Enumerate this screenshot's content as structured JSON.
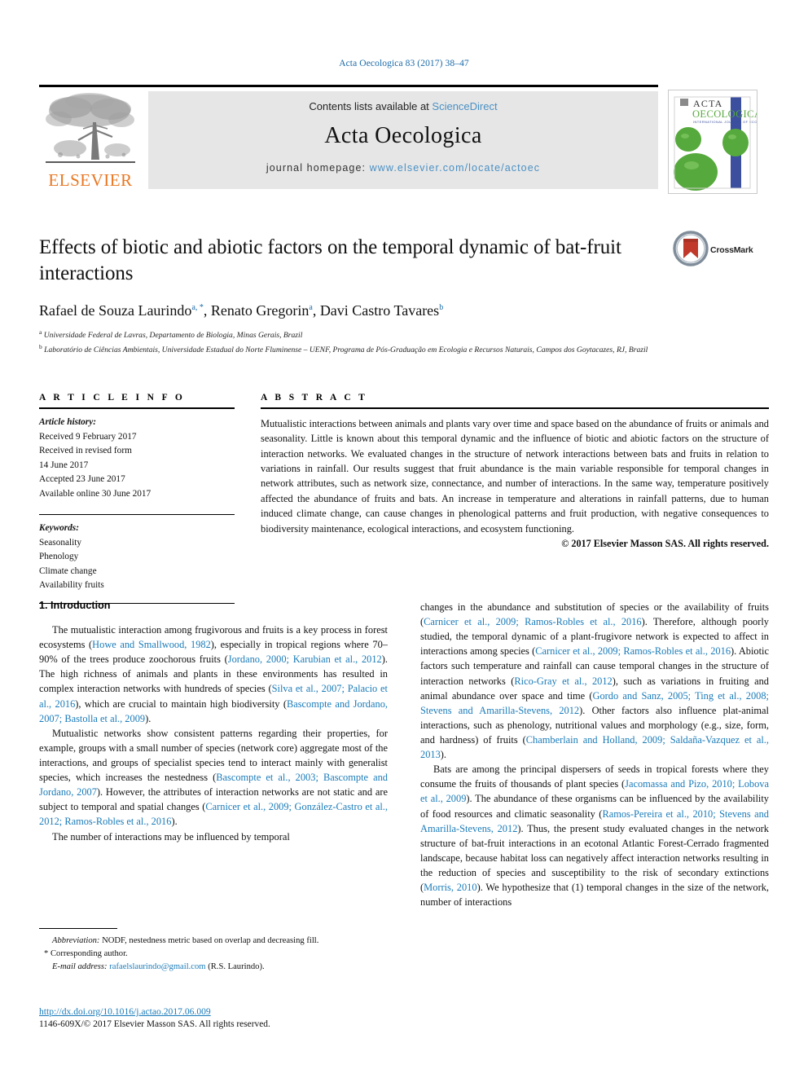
{
  "running_head": "Acta Oecologica 83 (2017) 38–47",
  "header": {
    "contents_prefix": "Contents lists available at ",
    "sciencedirect": "ScienceDirect",
    "journal_title": "Acta Oecologica",
    "homepage_prefix": "journal homepage: ",
    "homepage_url": "www.elsevier.com/locate/actoec",
    "publisher": "ELSEVIER",
    "cover_line1": "ACTA",
    "cover_line2": "OECOLOGICA",
    "cover_line3": "INTERNATIONAL JOURNAL OF ECOLOGY"
  },
  "colors": {
    "link": "#1a7bb9",
    "sciencedirect": "#4a90c4",
    "elsevier_orange": "#E87722",
    "band_gray": "#e6e6e6",
    "cover_green": "#56a93c",
    "cover_blue": "#3b4f9e",
    "crossmark_red": "#c0392b"
  },
  "title": "Effects of biotic and abiotic factors on the temporal dynamic of bat-fruit interactions",
  "authors": [
    {
      "name": "Rafael de Souza Laurindo",
      "marks": "a, *"
    },
    {
      "name": "Renato Gregorin",
      "marks": "a"
    },
    {
      "name": "Davi Castro Tavares",
      "marks": "b"
    }
  ],
  "affiliations": [
    {
      "mark": "a",
      "text": "Universidade Federal de Lavras, Departamento de Biologia, Minas Gerais, Brazil"
    },
    {
      "mark": "b",
      "text": "Laboratório de Ciências Ambientais, Universidade Estadual do Norte Fluminense – UENF, Programa de Pós-Graduação em Ecologia e Recursos Naturais, Campos dos Goytacazes, RJ, Brazil"
    }
  ],
  "crossmark": {
    "label": "CrossMark"
  },
  "article_info": {
    "heading": "A R T I C L E   I N F O",
    "history_label": "Article history:",
    "history": [
      "Received 9 February 2017",
      "Received in revised form",
      "14 June 2017",
      "Accepted 23 June 2017",
      "Available online 30 June 2017"
    ],
    "keywords_label": "Keywords:",
    "keywords": [
      "Seasonality",
      "Phenology",
      "Climate change",
      "Availability fruits"
    ]
  },
  "abstract": {
    "heading": "A B S T R A C T",
    "text": "Mutualistic interactions between animals and plants vary over time and space based on the abundance of fruits or animals and seasonality. Little is known about this temporal dynamic and the influence of biotic and abiotic factors on the structure of interaction networks. We evaluated changes in the structure of network interactions between bats and fruits in relation to variations in rainfall. Our results suggest that fruit abundance is the main variable responsible for temporal changes in network attributes, such as network size, connectance, and number of interactions. In the same way, temperature positively affected the abundance of fruits and bats. An increase in temperature and alterations in rainfall patterns, due to human induced climate change, can cause changes in phenological patterns and fruit production, with negative consequences to biodiversity maintenance, ecological interactions, and ecosystem functioning.",
    "copyright": "© 2017 Elsevier Masson SAS. All rights reserved."
  },
  "sections": {
    "introduction_title": "1. Introduction"
  },
  "body": {
    "left_paragraphs": [
      [
        {
          "t": "The mutualistic interaction among frugivorous and fruits is a key process in forest ecosystems ("
        },
        {
          "t": "Howe and Smallwood, 1982",
          "ref": true
        },
        {
          "t": "), especially in tropical regions where 70–90% of the trees produce zoochorous fruits ("
        },
        {
          "t": "Jordano, 2000; Karubian et al., 2012",
          "ref": true
        },
        {
          "t": "). The high richness of animals and plants in these environments has resulted in complex interaction networks with hundreds of species ("
        },
        {
          "t": "Silva et al., 2007; Palacio et al., 2016",
          "ref": true
        },
        {
          "t": "), which are crucial to maintain high biodiversity ("
        },
        {
          "t": "Bascompte and Jordano, 2007; Bastolla et al., 2009",
          "ref": true
        },
        {
          "t": ")."
        }
      ],
      [
        {
          "t": "Mutualistic networks show consistent patterns regarding their properties, for example, groups with a small number of species (network core) aggregate most of the interactions, and groups of specialist species tend to interact mainly with generalist species, which increases the nestedness ("
        },
        {
          "t": "Bascompte et al., 2003; Bascompte and Jordano, 2007",
          "ref": true
        },
        {
          "t": "). However, the attributes of interaction networks are not static and are subject to temporal and spatial changes ("
        },
        {
          "t": "Carnicer et al., 2009; González-Castro et al., 2012; Ramos-Robles et al., 2016",
          "ref": true
        },
        {
          "t": ")."
        }
      ],
      [
        {
          "t": "The number of interactions may be influenced by temporal"
        }
      ]
    ],
    "right_paragraphs": [
      [
        {
          "t": "changes in the abundance and substitution of species or the availability of fruits ("
        },
        {
          "t": "Carnicer et al., 2009; Ramos-Robles et al., 2016",
          "ref": true
        },
        {
          "t": "). Therefore, although poorly studied, the temporal dynamic of a plant-frugivore network is expected to affect in interactions among species ("
        },
        {
          "t": "Carnicer et al., 2009; Ramos-Robles et al., 2016",
          "ref": true
        },
        {
          "t": "). Abiotic factors such temperature and rainfall can cause temporal changes in the structure of interaction networks ("
        },
        {
          "t": "Rico-Gray et al., 2012",
          "ref": true
        },
        {
          "t": "), such as variations in fruiting and animal abundance over space and time ("
        },
        {
          "t": "Gordo and Sanz, 2005; Ting et al., 2008; Stevens and Amarilla-Stevens, 2012",
          "ref": true
        },
        {
          "t": "). Other factors also influence plat-animal interactions, such as phenology, nutritional values and morphology (e.g., size, form, and hardness) of fruits ("
        },
        {
          "t": "Chamberlain and Holland, 2009; Saldaña-Vazquez et al., 2013",
          "ref": true
        },
        {
          "t": ")."
        }
      ],
      [
        {
          "t": "Bats are among the principal dispersers of seeds in tropical forests where they consume the fruits of thousands of plant species ("
        },
        {
          "t": "Jacomassa and Pizo, 2010; Lobova et al., 2009",
          "ref": true
        },
        {
          "t": "). The abundance of these organisms can be influenced by the availability of food resources and climatic seasonality ("
        },
        {
          "t": "Ramos-Pereira et al., 2010; Stevens and Amarilla-Stevens, 2012",
          "ref": true
        },
        {
          "t": "). Thus, the present study evaluated changes in the network structure of bat-fruit interactions in an ecotonal Atlantic Forest-Cerrado fragmented landscape, because habitat loss can negatively affect interaction networks resulting in the reduction of species and susceptibility to the risk of secondary extinctions ("
        },
        {
          "t": "Morris, 2010",
          "ref": true
        },
        {
          "t": "). We hypothesize that (1) temporal changes in the size of the network, number of interactions"
        }
      ]
    ]
  },
  "footnotes": {
    "abbreviation_label": "Abbreviation:",
    "abbreviation_text": " NODF, nestedness metric based on overlap and decreasing fill.",
    "corresponding_star": "*",
    "corresponding_text": "Corresponding author.",
    "email_label": "E-mail address:",
    "email": "rafaelslaurindo@gmail.com",
    "email_suffix": " (R.S. Laurindo)."
  },
  "doi": {
    "url": "http://dx.doi.org/10.1016/j.actao.2017.06.009",
    "issn_line": "1146-609X/© 2017 Elsevier Masson SAS. All rights reserved."
  }
}
